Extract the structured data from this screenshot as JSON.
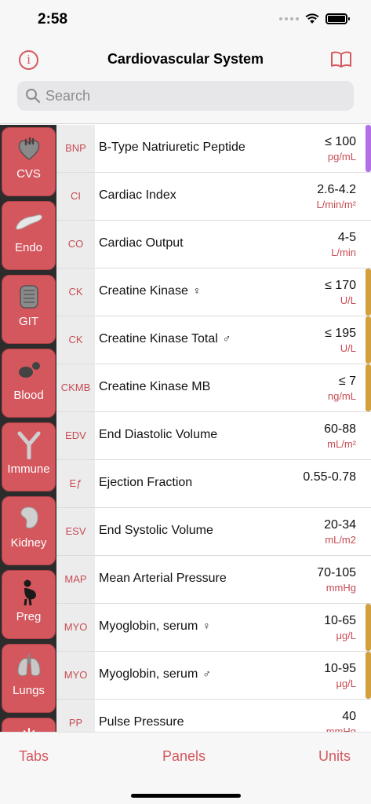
{
  "status_bar": {
    "time": "2:58"
  },
  "nav": {
    "title": "Cardiovascular System",
    "search_placeholder": "Search"
  },
  "sidebar": {
    "items": [
      {
        "label": "CVS",
        "icon": "heart-icon"
      },
      {
        "label": "Endo",
        "icon": "pancreas-icon"
      },
      {
        "label": "GIT",
        "icon": "intestines-icon"
      },
      {
        "label": "Blood",
        "icon": "blood-drop-icon"
      },
      {
        "label": "Immune",
        "icon": "antibody-icon"
      },
      {
        "label": "Kidney",
        "icon": "kidney-icon"
      },
      {
        "label": "Preg",
        "icon": "pregnancy-icon"
      },
      {
        "label": "Lungs",
        "icon": "lungs-icon"
      },
      {
        "label": "",
        "icon": "sun-icon"
      }
    ]
  },
  "rows": [
    {
      "abbr": "BNP",
      "name": "B-Type Natriuretic Peptide",
      "gender": "",
      "value": "≤ 100",
      "unit": "pg/mL",
      "marker": "#b46ee6"
    },
    {
      "abbr": "CI",
      "name": "Cardiac Index",
      "gender": "",
      "value": "2.6-4.2",
      "unit": "L/min/m²",
      "marker": ""
    },
    {
      "abbr": "CO",
      "name": "Cardiac Output",
      "gender": "",
      "value": "4-5",
      "unit": "L/min",
      "marker": ""
    },
    {
      "abbr": "CK",
      "name": "Creatine Kinase",
      "gender": "♀",
      "value": "≤ 170",
      "unit": "U/L",
      "marker": "#d3a040"
    },
    {
      "abbr": "CK",
      "name": "Creatine Kinase Total",
      "gender": "♂",
      "value": "≤ 195",
      "unit": "U/L",
      "marker": "#d3a040"
    },
    {
      "abbr": "CKMB",
      "name": "Creatine Kinase MB",
      "gender": "",
      "value": "≤ 7",
      "unit": "ng/mL",
      "marker": "#d3a040"
    },
    {
      "abbr": "EDV",
      "name": "End Diastolic Volume",
      "gender": "",
      "value": "60-88",
      "unit": "mL/m²",
      "marker": ""
    },
    {
      "abbr": "Eƒ",
      "name": "Ejection Fraction",
      "gender": "",
      "value": "0.55-0.78",
      "unit": "",
      "marker": ""
    },
    {
      "abbr": "ESV",
      "name": "End Systolic Volume",
      "gender": "",
      "value": "20-34",
      "unit": "mL/m2",
      "marker": ""
    },
    {
      "abbr": "MAP",
      "name": "Mean Arterial Pressure",
      "gender": "",
      "value": "70-105",
      "unit": "mmHg",
      "marker": ""
    },
    {
      "abbr": "MYO",
      "name": "Myoglobin, serum",
      "gender": "♀",
      "value": "10-65",
      "unit": "μg/L",
      "marker": "#d3a040"
    },
    {
      "abbr": "MYO",
      "name": "Myoglobin, serum",
      "gender": "♂",
      "value": "10-95",
      "unit": "μg/L",
      "marker": "#d3a040"
    },
    {
      "abbr": "PP",
      "name": "Pulse Pressure",
      "gender": "",
      "value": "40",
      "unit": "mmHg",
      "marker": ""
    }
  ],
  "bottom_bar": {
    "tabs_label": "Tabs",
    "panels_label": "Panels",
    "units_label": "Units"
  },
  "colors": {
    "accent": "#d4575e",
    "purple_marker": "#b46ee6",
    "gold_marker": "#d3a040"
  }
}
